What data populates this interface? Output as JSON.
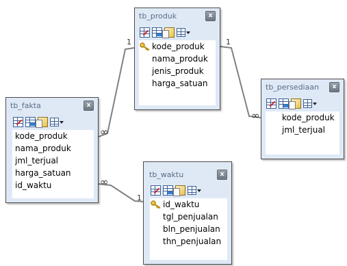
{
  "tables": {
    "tb_produk": {
      "title": "tb_produk",
      "close": "x",
      "fields": [
        {
          "name": "kode_produk",
          "key": true
        },
        {
          "name": "nama_produk",
          "key": false
        },
        {
          "name": "jenis_produk",
          "key": false
        },
        {
          "name": "harga_satuan",
          "key": false
        }
      ]
    },
    "tb_fakta": {
      "title": "tb_fakta",
      "close": "x",
      "fields": [
        {
          "name": "kode_produk",
          "key": false
        },
        {
          "name": "nama_produk",
          "key": false
        },
        {
          "name": "jml_terjual",
          "key": false
        },
        {
          "name": "harga_satuan",
          "key": false
        },
        {
          "name": "id_waktu",
          "key": false
        }
      ]
    },
    "tb_persediaan": {
      "title": "tb_persediaan",
      "close": "x",
      "fields": [
        {
          "name": "kode_produk",
          "key": false
        },
        {
          "name": "jml_terjual",
          "key": false
        }
      ]
    },
    "tb_waktu": {
      "title": "tb_waktu",
      "close": "x",
      "fields": [
        {
          "name": "id_waktu",
          "key": true
        },
        {
          "name": "tgl_penjualan",
          "key": false
        },
        {
          "name": "bln_penjualan",
          "key": false
        },
        {
          "name": "thn_penjualan",
          "key": false
        }
      ]
    }
  },
  "relationships": {
    "produk_fakta": {
      "one": "1",
      "many": "∞"
    },
    "produk_persediaan": {
      "one": "1",
      "many": "∞"
    },
    "waktu_fakta": {
      "one": "1",
      "many": "∞"
    }
  },
  "toolbar_icons": [
    "delete-table-icon",
    "primary-key-icon",
    "properties-icon",
    "view-dropdown-icon"
  ],
  "colors": {
    "table_bg": "#dfe9f6",
    "title_text": "#5a6c86",
    "line": "#808080"
  }
}
